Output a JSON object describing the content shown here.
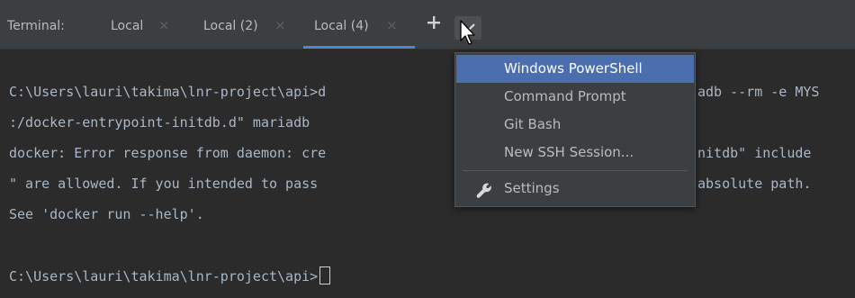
{
  "tabbar": {
    "label": "Terminal:",
    "tabs": [
      {
        "label": "Local",
        "close": "×"
      },
      {
        "label": "Local (2)",
        "close": "×"
      },
      {
        "label": "Local (4)",
        "close": "×"
      }
    ],
    "add_icon": "plus-icon",
    "more_icon": "chevron-down-icon",
    "colors": {
      "active_underline": "#4a88c7",
      "background": "#3c3f41"
    }
  },
  "terminal": {
    "lines": [
      "C:\\Users\\lauri\\takima\\lnr-project\\api>d",
      ":/docker-entrypoint-initdb.d\" mariadb",
      "docker: Error response from daemon: cre",
      "\" are allowed. If you intended to pass",
      "See 'docker run --help'.",
      "",
      "C:\\Users\\lauri\\takima\\lnr-project\\api>"
    ],
    "right_fragments": [
      "adb --rm -e MYS",
      "nitdb\" include",
      "absolute path."
    ]
  },
  "menu": {
    "items": [
      {
        "label": "Windows PowerShell",
        "selected": true
      },
      {
        "label": "Command Prompt",
        "selected": false
      },
      {
        "label": "Git Bash",
        "selected": false
      },
      {
        "label": "New SSH Session...",
        "selected": false
      }
    ],
    "settings": {
      "label": "Settings",
      "icon": "wrench-icon"
    },
    "colors": {
      "selected_bg": "#4b6eaf"
    }
  }
}
